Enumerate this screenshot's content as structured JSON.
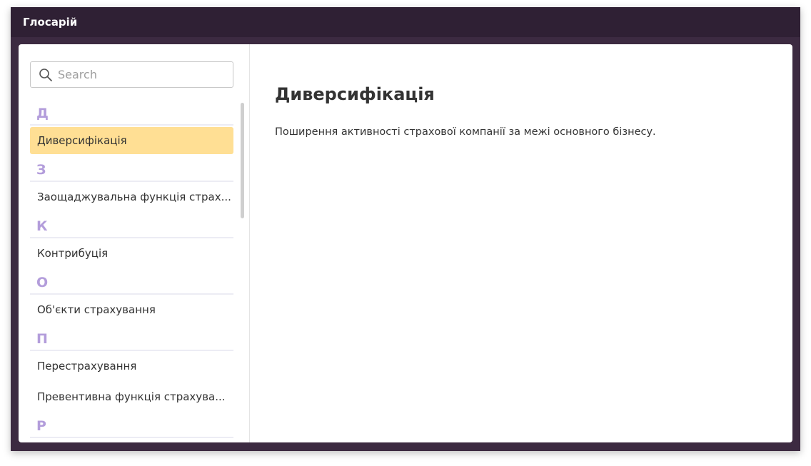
{
  "window": {
    "title": "Глосарій"
  },
  "search": {
    "placeholder": "Search",
    "value": ""
  },
  "glossary": {
    "groups": [
      {
        "letter": "Д",
        "terms": [
          {
            "label": "Диверсифікація",
            "active": true
          }
        ]
      },
      {
        "letter": "З",
        "terms": [
          {
            "label": "Заощаджувальна функція страх...",
            "active": false
          }
        ]
      },
      {
        "letter": "К",
        "terms": [
          {
            "label": "Контрибуція",
            "active": false
          }
        ]
      },
      {
        "letter": "О",
        "terms": [
          {
            "label": "Об'єкти страхування",
            "active": false
          }
        ]
      },
      {
        "letter": "П",
        "terms": [
          {
            "label": "Перестрахування",
            "active": false
          },
          {
            "label": "Превентивна функція страхува...",
            "active": false
          }
        ]
      },
      {
        "letter": "Р",
        "terms": []
      }
    ]
  },
  "detail": {
    "title": "Диверсифікація",
    "definition": "Поширення активності страхової компанії за межі основного бізнесу."
  },
  "colors": {
    "titlebar": "#2f2034",
    "frame": "#3c2a41",
    "letter": "#b39ddb",
    "active_item": "#ffdf94"
  },
  "icons": {
    "search": "search-icon"
  }
}
